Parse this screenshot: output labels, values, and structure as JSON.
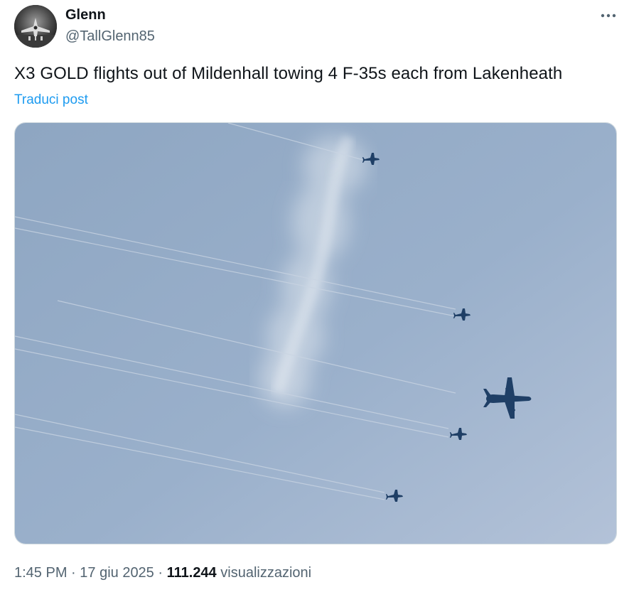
{
  "author": {
    "name": "Glenn",
    "handle": "@TallGlenn85"
  },
  "post": {
    "text": "X3 GOLD flights out of Mildenhall towing 4 F-35s each from Lakenheath",
    "translate_label": "Traduci post"
  },
  "meta": {
    "time": "1:45 PM",
    "separator": " · ",
    "date": "17 giu 2025",
    "views_count": "111.244",
    "views_label": "visualizzazioni"
  },
  "icons": {
    "more": "more-horizontal-icon"
  },
  "colors": {
    "text_primary": "#0f1419",
    "text_secondary": "#536471",
    "link": "#1d9bf0",
    "border": "#cfd9de",
    "sky": "#9bb1cb",
    "aircraft": "#1f3f66"
  }
}
